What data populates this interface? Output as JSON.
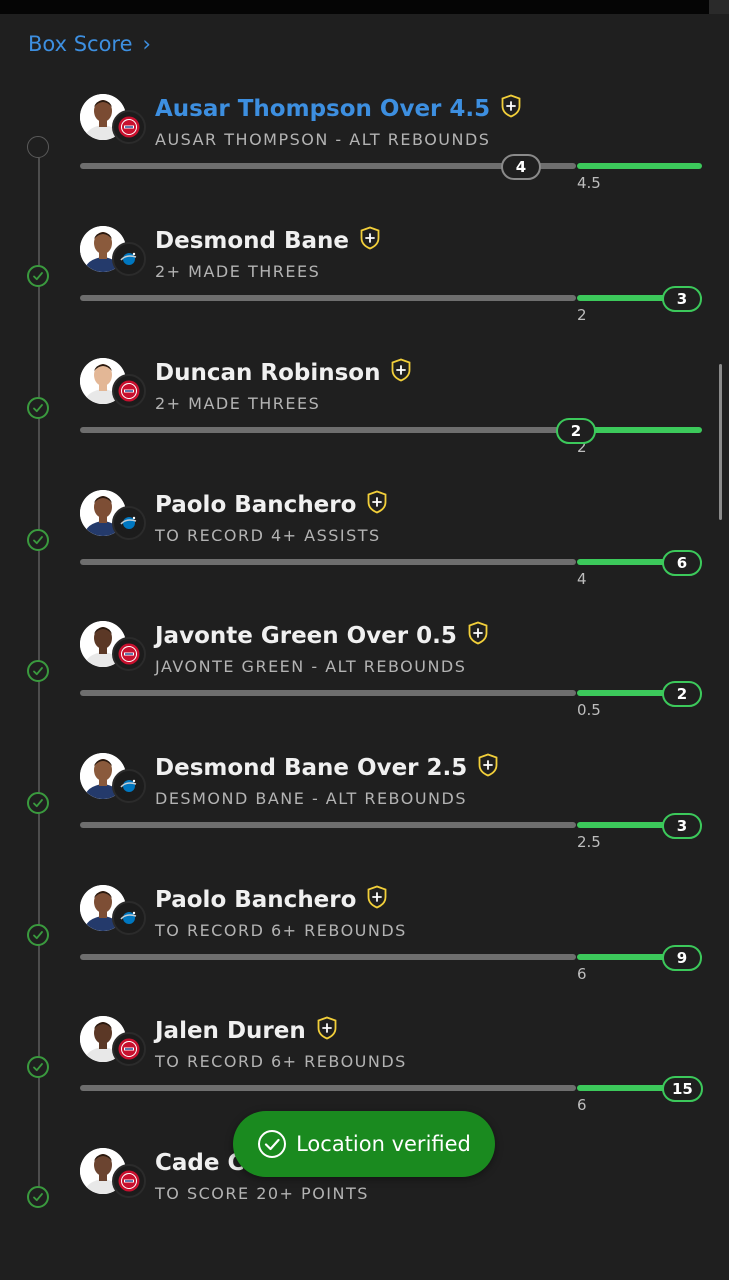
{
  "header": {
    "box_score_label": "Box Score",
    "chevron": "›"
  },
  "toast": {
    "label": "Location verified"
  },
  "colors": {
    "accent": "#3d8fe0",
    "progress": "#3cc95b",
    "track": "#6e6e6e",
    "toast": "#1a8a1f"
  },
  "legs": [
    {
      "title": "Ausar Thompson Over 4.5",
      "subtitle": "AUSAR THOMPSON - ALT REBOUNDS",
      "line": "4.5",
      "current": "4",
      "status": "pending",
      "team": "pistons-logo",
      "progress": 0.89
    },
    {
      "title": "Desmond Bane",
      "subtitle": "2+ MADE THREES",
      "line": "2",
      "current": "3",
      "status": "hit",
      "team": "magic-logo",
      "progress": 1
    },
    {
      "title": "Duncan Robinson",
      "subtitle": "2+ MADE THREES",
      "line": "2",
      "current": "2",
      "status": "hit",
      "team": "pistons-logo",
      "progress": 1
    },
    {
      "title": "Paolo Banchero",
      "subtitle": "TO RECORD 4+ ASSISTS",
      "line": "4",
      "current": "6",
      "status": "hit",
      "team": "magic-logo",
      "progress": 1
    },
    {
      "title": "Javonte Green Over 0.5",
      "subtitle": "JAVONTE GREEN - ALT REBOUNDS",
      "line": "0.5",
      "current": "2",
      "status": "hit",
      "team": "pistons-logo",
      "progress": 1
    },
    {
      "title": "Desmond Bane Over 2.5",
      "subtitle": "DESMOND BANE - ALT REBOUNDS",
      "line": "2.5",
      "current": "3",
      "status": "hit",
      "team": "magic-logo",
      "progress": 1
    },
    {
      "title": "Paolo Banchero",
      "subtitle": "TO RECORD 6+ REBOUNDS",
      "line": "6",
      "current": "9",
      "status": "hit",
      "team": "magic-logo",
      "progress": 1
    },
    {
      "title": "Jalen Duren",
      "subtitle": "TO RECORD 6+ REBOUNDS",
      "line": "6",
      "current": "15",
      "status": "hit",
      "team": "pistons-logo",
      "progress": 1
    },
    {
      "title": "Cade Cunningham",
      "subtitle": "TO SCORE 20+ POINTS",
      "status": "hit",
      "team": "pistons-logo"
    }
  ]
}
